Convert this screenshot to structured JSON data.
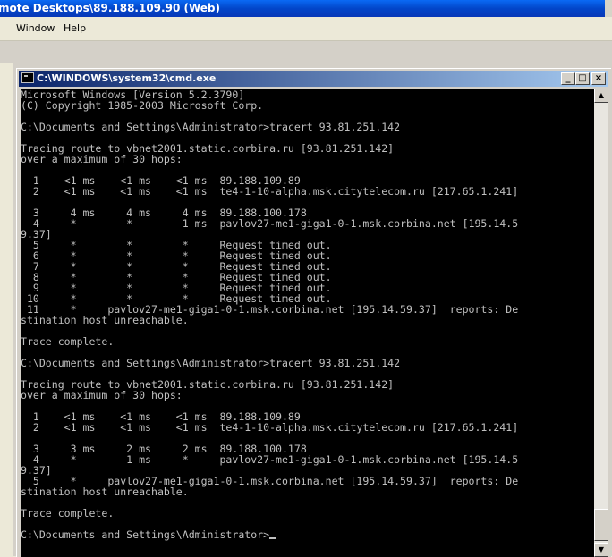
{
  "outer_window": {
    "title": "mote Desktops\\89.188.109.90 (Web)"
  },
  "menu": {
    "items": [
      "Window",
      "Help"
    ]
  },
  "cmd_window": {
    "title": "C:\\WINDOWS\\system32\\cmd.exe",
    "minimize_glyph": "_",
    "maximize_glyph": "□",
    "close_glyph": "×"
  },
  "console": {
    "lines": [
      "Microsoft Windows [Version 5.2.3790]",
      "(C) Copyright 1985-2003 Microsoft Corp.",
      "",
      "C:\\Documents and Settings\\Administrator>tracert 93.81.251.142",
      "",
      "Tracing route to vbnet2001.static.corbina.ru [93.81.251.142]",
      "over a maximum of 30 hops:",
      "",
      "  1    <1 ms    <1 ms    <1 ms  89.188.109.89",
      "  2    <1 ms    <1 ms    <1 ms  te4-1-10-alpha.msk.citytelecom.ru [217.65.1.241]",
      "",
      "  3     4 ms     4 ms     4 ms  89.188.100.178",
      "  4     *        *        1 ms  pavlov27-me1-giga1-0-1.msk.corbina.net [195.14.5",
      "9.37]",
      "  5     *        *        *     Request timed out.",
      "  6     *        *        *     Request timed out.",
      "  7     *        *        *     Request timed out.",
      "  8     *        *        *     Request timed out.",
      "  9     *        *        *     Request timed out.",
      " 10     *        *        *     Request timed out.",
      " 11     *     pavlov27-me1-giga1-0-1.msk.corbina.net [195.14.59.37]  reports: De",
      "stination host unreachable.",
      "",
      "Trace complete.",
      "",
      "C:\\Documents and Settings\\Administrator>tracert 93.81.251.142",
      "",
      "Tracing route to vbnet2001.static.corbina.ru [93.81.251.142]",
      "over a maximum of 30 hops:",
      "",
      "  1    <1 ms    <1 ms    <1 ms  89.188.109.89",
      "  2    <1 ms    <1 ms    <1 ms  te4-1-10-alpha.msk.citytelecom.ru [217.65.1.241]",
      "",
      "  3     3 ms     2 ms     2 ms  89.188.100.178",
      "  4     *        1 ms     *     pavlov27-me1-giga1-0-1.msk.corbina.net [195.14.5",
      "9.37]",
      "  5     *     pavlov27-me1-giga1-0-1.msk.corbina.net [195.14.59.37]  reports: De",
      "stination host unreachable.",
      "",
      "Trace complete.",
      ""
    ],
    "prompt": "C:\\Documents and Settings\\Administrator>"
  }
}
